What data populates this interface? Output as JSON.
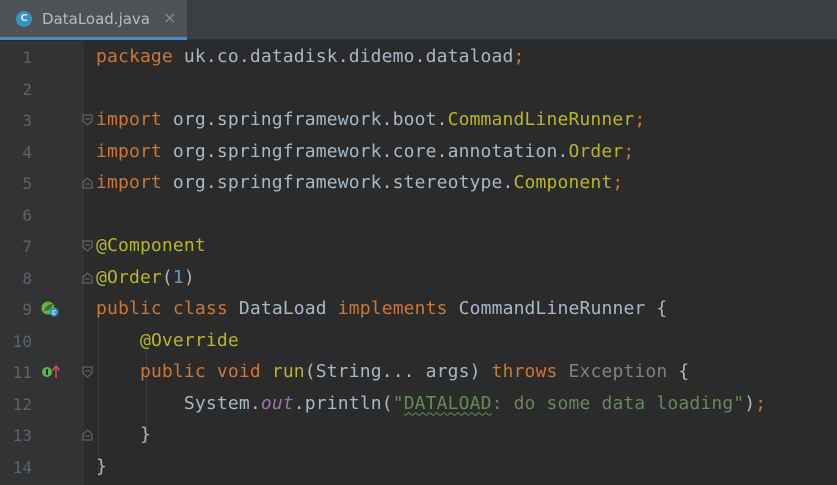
{
  "tab": {
    "filename": "DataLoad.java",
    "icon_letter": "C",
    "close_glyph": "×"
  },
  "editor": {
    "lines": [
      {
        "n": "1"
      },
      {
        "n": "2"
      },
      {
        "n": "3"
      },
      {
        "n": "4"
      },
      {
        "n": "5"
      },
      {
        "n": "6"
      },
      {
        "n": "7"
      },
      {
        "n": "8"
      },
      {
        "n": "9"
      },
      {
        "n": "10"
      },
      {
        "n": "11"
      },
      {
        "n": "12"
      },
      {
        "n": "13"
      },
      {
        "n": "14"
      }
    ],
    "tokens": {
      "l1_kw": "package",
      "l1_rest": " uk.co.datadisk.didemo.dataload",
      "semi": ";",
      "import_kw": "import",
      "l3_pkg": " org.springframework.boot.",
      "l3_cls": "CommandLineRunner",
      "l4_pkg": " org.springframework.core.annotation.",
      "l4_cls": "Order",
      "l5_pkg": " org.springframework.stereotype.",
      "l5_cls": "Component",
      "l7_ann": "@Component",
      "l8_ann": "@Order",
      "l8_open": "(",
      "l8_num": "1",
      "l8_close": ")",
      "l9_public": "public",
      "l9_class": "class",
      "l9_name": "DataLoad",
      "l9_impl": "implements",
      "l9_iface": "CommandLineRunner {",
      "l10_ann": "@Override",
      "l11_public": "public",
      "l11_void": "void",
      "l11_run": "run",
      "l11_params": "(String... args)",
      "l11_throws": "throws",
      "l11_exc": "Exception",
      "l11_brace": " {",
      "l12_sys": "System.",
      "l12_out": "out",
      "l12_println": ".println(",
      "l12_q1": "\"",
      "l12_typo": "DATALOAD",
      "l12_str": ": do some data loading\"",
      "l12_end": ")",
      "l13_brace": "}",
      "l14_brace": "}"
    }
  },
  "colors": {
    "keyword": "#cc7832",
    "annotation": "#bbb529",
    "string": "#6a8759",
    "number": "#6897bb",
    "static_field": "#9876aa",
    "default_text": "#a9b7c6",
    "background": "#2b2b2b"
  },
  "icons": {
    "tab_icon": "java-class-icon",
    "run_gutter": "run-spring-bean-icon",
    "implements_gutter": "implements-method-icon",
    "fold": "fold-marker-icon"
  }
}
